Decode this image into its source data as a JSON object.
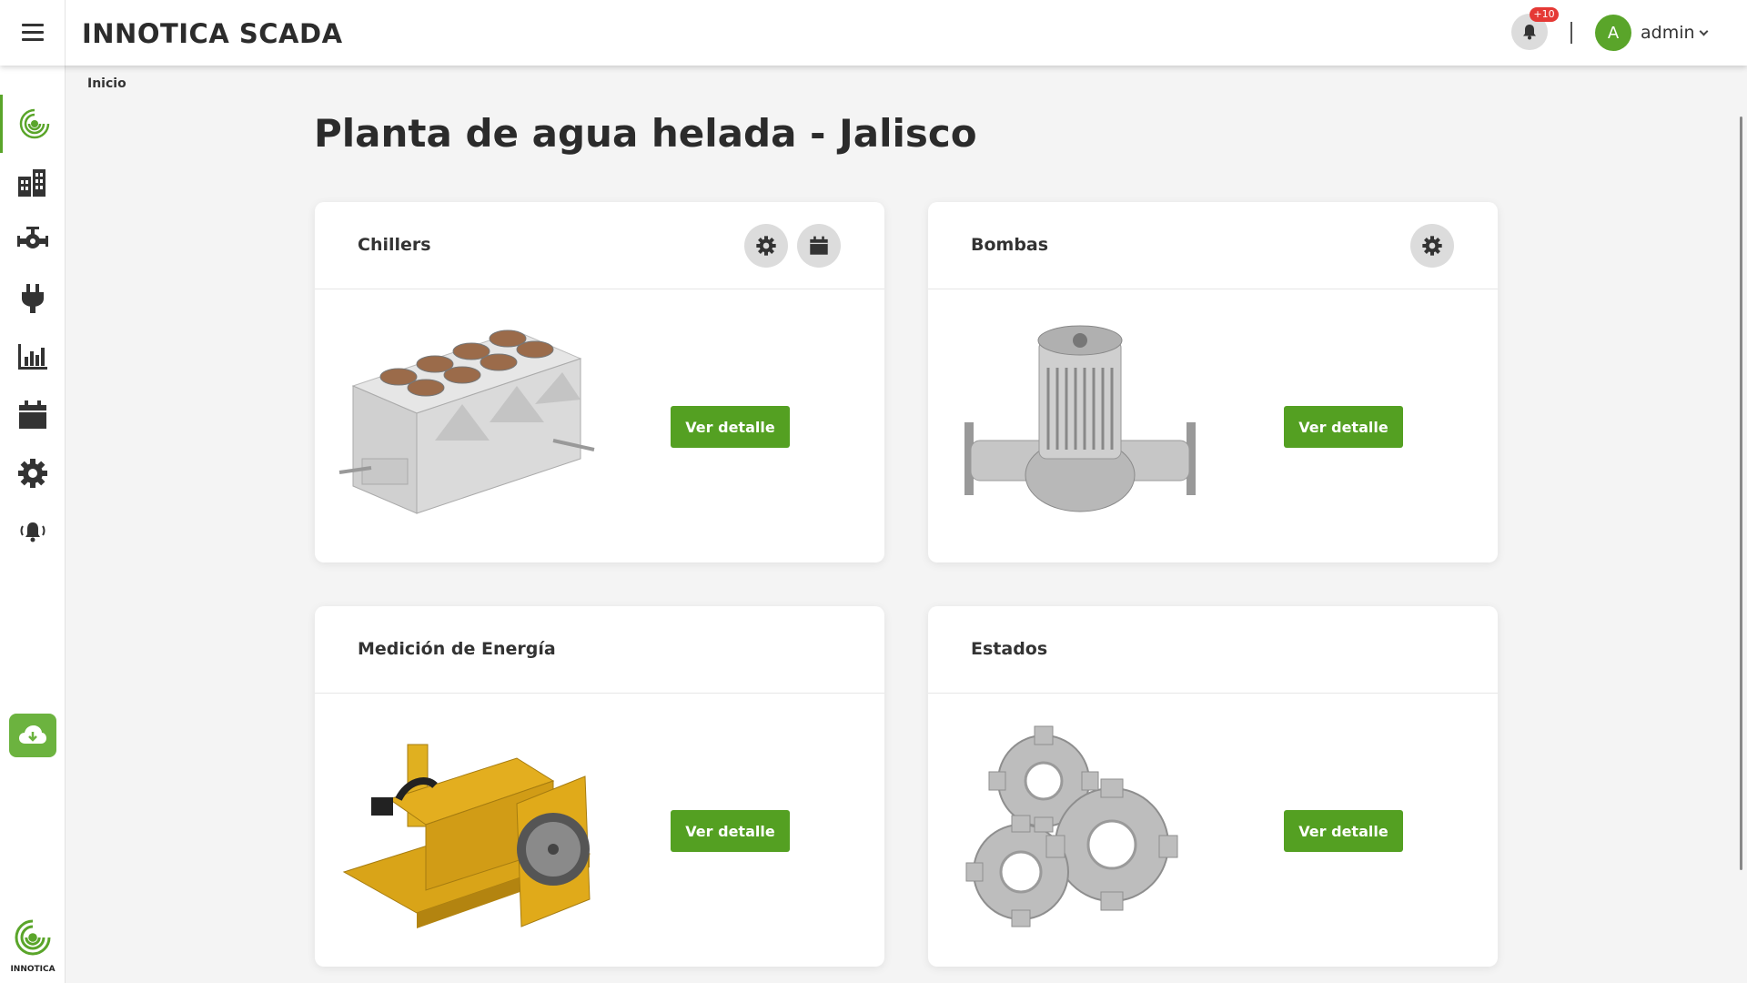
{
  "header": {
    "title": "INNOTICA SCADA",
    "notifications_badge": "+10",
    "user_initial": "A",
    "username": "admin"
  },
  "breadcrumb": "Inicio",
  "page_title": "Planta de agua helada - Jalisco",
  "sidebar": {
    "items": [
      {
        "icon": "innotica-logo-icon",
        "active": true
      },
      {
        "icon": "building-icon"
      },
      {
        "icon": "valve-pipe-icon"
      },
      {
        "icon": "plug-icon"
      },
      {
        "icon": "bar-chart-icon"
      },
      {
        "icon": "calendar-icon"
      },
      {
        "icon": "gear-icon"
      },
      {
        "icon": "alarm-bell-icon"
      }
    ],
    "download_icon": "cloud-download-icon",
    "logo_text": "INNOTICA"
  },
  "cards": [
    {
      "title": "Chillers",
      "button": "Ver detalle",
      "image": "chiller-unit"
    },
    {
      "title": "Bombas",
      "button": "Ver detalle",
      "image": "pump"
    },
    {
      "title": "Medición de Energía",
      "button": "Ver detalle",
      "image": "generator"
    },
    {
      "title": "Estados",
      "button": "Ver detalle",
      "image": "gears"
    }
  ],
  "colors": {
    "accent": "#5aa52a",
    "button": "#54a022",
    "badge": "#e53935"
  }
}
